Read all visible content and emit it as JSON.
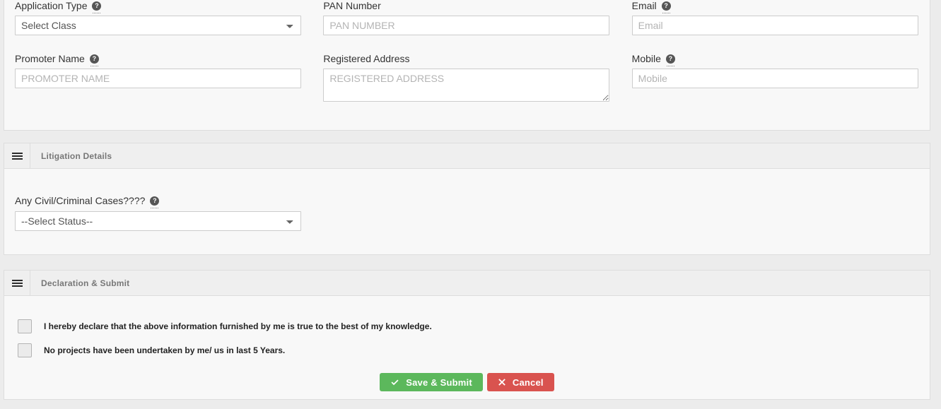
{
  "sections": [
    {
      "id": "details",
      "title": "",
      "fields": {
        "application_type": {
          "label": "Application Type",
          "help_icon": "question-circle-icon",
          "value": "Select Class",
          "options": [
            "Select Class"
          ]
        },
        "promoter_name": {
          "label": "Promoter Name",
          "help_icon": "question-circle-icon",
          "value": "",
          "placeholder": "PROMOTER NAME"
        },
        "pan_number": {
          "label": "PAN Number",
          "value": "",
          "placeholder": "PAN NUMBER"
        },
        "registered_address": {
          "label": "Registered Address",
          "value": "",
          "placeholder": "REGISTERED ADDRESS"
        },
        "email": {
          "label": "Email",
          "help_icon": "question-circle-icon",
          "value": "",
          "placeholder": "Email"
        },
        "mobile": {
          "label": "Mobile",
          "help_icon": "question-circle-icon",
          "value": "",
          "placeholder": "Mobile"
        }
      }
    },
    {
      "id": "litigation",
      "title": "Litigation Details",
      "grip_icon": "hamburger-icon",
      "fields": {
        "civil_criminal_cases": {
          "label": "Any Civil/Criminal Cases????",
          "help_icon": "question-circle-icon",
          "value": "--Select Status--",
          "options": [
            "--Select Status--"
          ]
        }
      }
    },
    {
      "id": "declaration",
      "title": "Declaration & Submit",
      "grip_icon": "hamburger-icon",
      "checkboxes": [
        {
          "label": "I hereby declare that the above information furnished by me is true to the best of my knowledge.",
          "checked": false
        },
        {
          "label": "No projects have been undertaken by me/ us in last 5 Years.",
          "checked": false
        }
      ],
      "buttons": {
        "save": {
          "label": "Save & Submit",
          "icon": "check-icon",
          "color": "#5cb85c"
        },
        "cancel": {
          "label": "Cancel",
          "icon": "times-icon",
          "color": "#d9534f"
        }
      }
    }
  ],
  "help_glyph": "?"
}
